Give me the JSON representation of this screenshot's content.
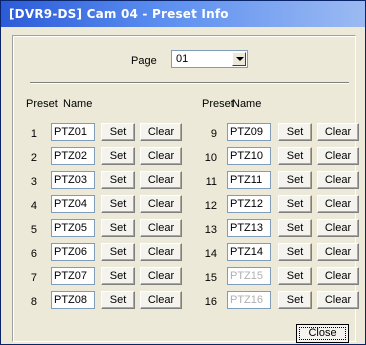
{
  "window": {
    "title": "[DVR9-DS] Cam 04 - Preset Info"
  },
  "page": {
    "label": "Page",
    "value": "01"
  },
  "headers": {
    "preset": "Preset",
    "name": "Name"
  },
  "buttons": {
    "set": "Set",
    "clear": "Clear",
    "close": "Close"
  },
  "left_presets": [
    {
      "num": "1",
      "name": "PTZ01",
      "enabled": true
    },
    {
      "num": "2",
      "name": "PTZ02",
      "enabled": true
    },
    {
      "num": "3",
      "name": "PTZ03",
      "enabled": true
    },
    {
      "num": "4",
      "name": "PTZ04",
      "enabled": true
    },
    {
      "num": "5",
      "name": "PTZ05",
      "enabled": true
    },
    {
      "num": "6",
      "name": "PTZ06",
      "enabled": true
    },
    {
      "num": "7",
      "name": "PTZ07",
      "enabled": true
    },
    {
      "num": "8",
      "name": "PTZ08",
      "enabled": true
    }
  ],
  "right_presets": [
    {
      "num": "9",
      "name": "PTZ09",
      "enabled": true
    },
    {
      "num": "10",
      "name": "PTZ10",
      "enabled": true
    },
    {
      "num": "11",
      "name": "PTZ11",
      "enabled": true
    },
    {
      "num": "12",
      "name": "PTZ12",
      "enabled": true
    },
    {
      "num": "13",
      "name": "PTZ13",
      "enabled": true
    },
    {
      "num": "14",
      "name": "PTZ14",
      "enabled": true
    },
    {
      "num": "15",
      "name": "PTZ15",
      "enabled": false
    },
    {
      "num": "16",
      "name": "PTZ16",
      "enabled": false
    }
  ]
}
